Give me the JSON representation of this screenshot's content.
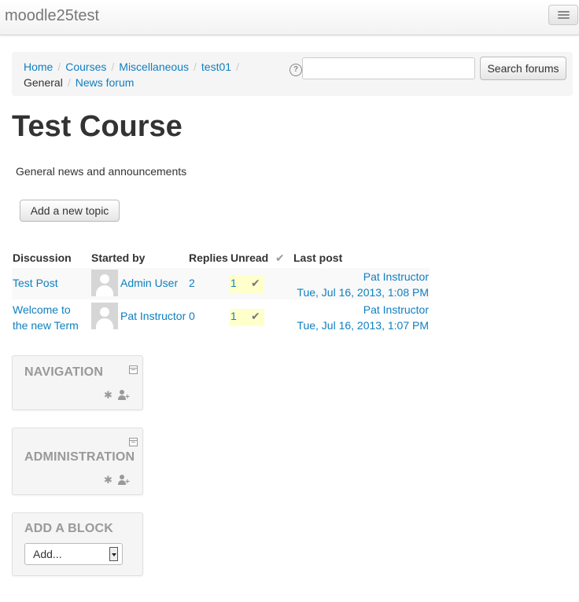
{
  "navbar": {
    "brand": "moodle25test"
  },
  "breadcrumb": {
    "items": [
      "Home",
      "Courses",
      "Miscellaneous",
      "test01",
      "General",
      "News forum"
    ],
    "separator": "/"
  },
  "search": {
    "help_icon": "?",
    "input_value": "",
    "button_label": "Search forums"
  },
  "page": {
    "title": "Test Course",
    "intro": "General news and announcements",
    "add_topic_label": "Add a new topic"
  },
  "forum_table": {
    "headers": {
      "discussion": "Discussion",
      "started_by": "Started by",
      "replies": "Replies",
      "unread": "Unread",
      "unread_check": "✔",
      "last_post": "Last post"
    },
    "rows": [
      {
        "discussion": "Test Post",
        "started_by": "Admin User",
        "replies": "2",
        "unread": "1",
        "unread_check": "✔",
        "last_post_author": "Pat Instructor",
        "last_post_date": "Tue, Jul 16, 2013, 1:08 PM"
      },
      {
        "discussion": "Welcome to the new Term",
        "started_by": "Pat Instructor",
        "replies": "0",
        "unread": "1",
        "unread_check": "✔",
        "last_post_author": "Pat Instructor",
        "last_post_date": "Tue, Jul 16, 2013, 1:07 PM"
      }
    ]
  },
  "blocks": {
    "navigation": {
      "title": "NAVIGATION",
      "gear": "✱"
    },
    "administration": {
      "title": "ADMINISTRATION",
      "gear": "✱"
    },
    "add_block": {
      "title": "ADD A BLOCK",
      "select_value": "Add..."
    }
  },
  "icons": {
    "menu": "hamburger-menu-icon",
    "help": "help-icon",
    "avatar": "user-avatar-icon",
    "check": "checkmark-icon",
    "toggle": "block-toggle-icon",
    "gear": "gear-icon",
    "assign_role": "assign-roles-icon",
    "dropdown": "dropdown-arrow-icon"
  },
  "colors": {
    "link": "#0e7fc0",
    "unread_highlight": "#ffffcc",
    "block_title": "#999999"
  }
}
